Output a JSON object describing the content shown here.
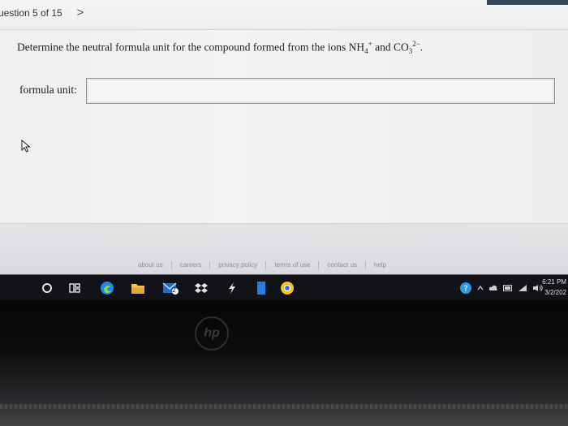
{
  "question_nav": {
    "label": "uestion 5 of 15",
    "next_glyph": ">"
  },
  "question": {
    "prefix": "Determine the neutral formula unit for the compound formed from the ions NH",
    "ion1_sub": "4",
    "ion1_sup": "+",
    "middle": " and CO",
    "ion2_sub": "3",
    "ion2_sup": "2−",
    "suffix": "."
  },
  "answer": {
    "label": "formula unit:",
    "value": "",
    "placeholder": ""
  },
  "footer": {
    "links": [
      "about us",
      "careers",
      "privacy policy",
      "terms of use",
      "contact us",
      "help"
    ]
  },
  "taskbar": {
    "icons": [
      "start-circle-icon",
      "task-view-icon",
      "edge-icon",
      "file-explorer-icon",
      "mail-icon",
      "dropbox-icon",
      "app-icon",
      "app-blue-icon",
      "chrome-icon"
    ],
    "mail_badge": "2",
    "tray_icons": [
      "help-icon",
      "chevron-up-icon",
      "cloud-icon",
      "battery-icon",
      "wifi-icon",
      "speaker-icon"
    ],
    "time": "6:21 PM",
    "date": "3/2/202"
  },
  "colors": {
    "edge": "#1e88e5",
    "chrome_yellow": "#f5c518",
    "taskbar": "#121318"
  }
}
